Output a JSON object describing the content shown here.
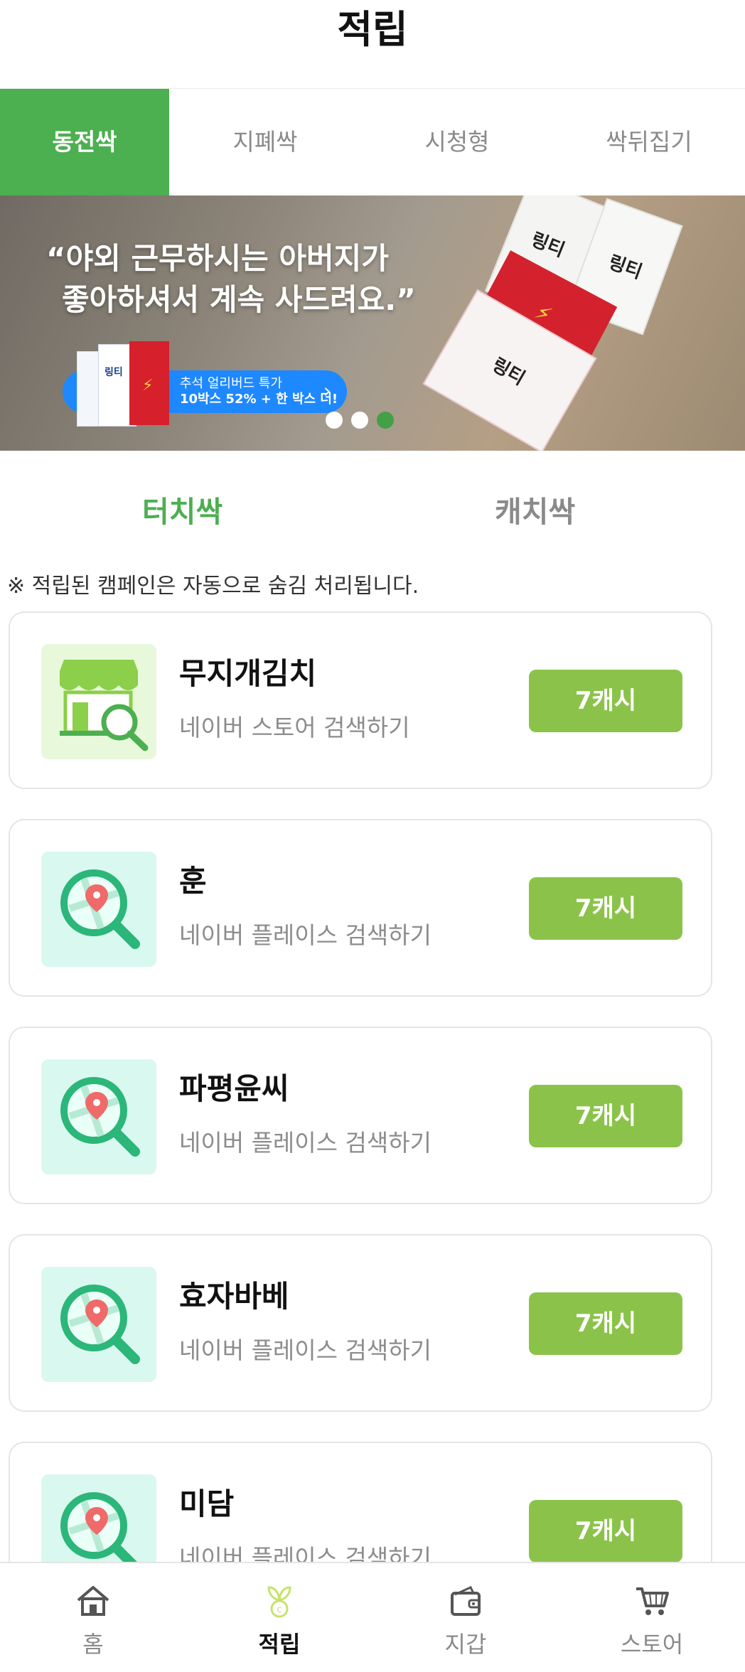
{
  "header": {
    "title": "적립"
  },
  "tabs": [
    {
      "label": "동전싹",
      "active": true
    },
    {
      "label": "지폐싹",
      "active": false
    },
    {
      "label": "시청형",
      "active": false
    },
    {
      "label": "싹뒤집기",
      "active": false
    }
  ],
  "banner": {
    "quote_line1": "“야외 근무하시는 아버지가",
    "quote_line2": "좋아하셔서 계속 사드려요.”",
    "promo_line1": "추석 얼리버드 특가",
    "promo_line2": "10박스 52% + 한 박스 더!",
    "product_label": "링티",
    "box_label": "링티",
    "chevron_icon": "chevron-right-icon",
    "page_indicator": {
      "count": 3,
      "active_index": 2
    }
  },
  "subtabs": [
    {
      "label": "터치싹",
      "active": true
    },
    {
      "label": "캐치싹",
      "active": false
    }
  ],
  "notice": "※ 적립된 캠페인은 자동으로 숨김 처리됩니다.",
  "campaigns": [
    {
      "name": "무지개김치",
      "description": "네이버 스토어 검색하기",
      "reward": "7캐시",
      "icon": "store-search-icon"
    },
    {
      "name": "훈",
      "description": "네이버 플레이스 검색하기",
      "reward": "7캐시",
      "icon": "map-search-icon"
    },
    {
      "name": "파평윤씨",
      "description": "네이버 플레이스 검색하기",
      "reward": "7캐시",
      "icon": "map-search-icon"
    },
    {
      "name": "효자바베",
      "description": "네이버 플레이스 검색하기",
      "reward": "7캐시",
      "icon": "map-search-icon"
    },
    {
      "name": "미담",
      "description": "네이버 플레이스 검색하기",
      "reward": "7캐시",
      "icon": "map-search-icon"
    }
  ],
  "bottom_nav": [
    {
      "label": "홈",
      "icon": "home-icon",
      "active": false
    },
    {
      "label": "적립",
      "icon": "sprout-coin-icon",
      "active": true
    },
    {
      "label": "지갑",
      "icon": "wallet-icon",
      "active": false
    },
    {
      "label": "스토어",
      "icon": "cart-icon",
      "active": false
    }
  ],
  "colors": {
    "accent": "#4caf50",
    "reward_button": "#8bc34a",
    "promo_blue": "#1e88ff",
    "store_thumb_bg": "#e8f8db",
    "place_thumb_bg": "#d9f8ef"
  }
}
